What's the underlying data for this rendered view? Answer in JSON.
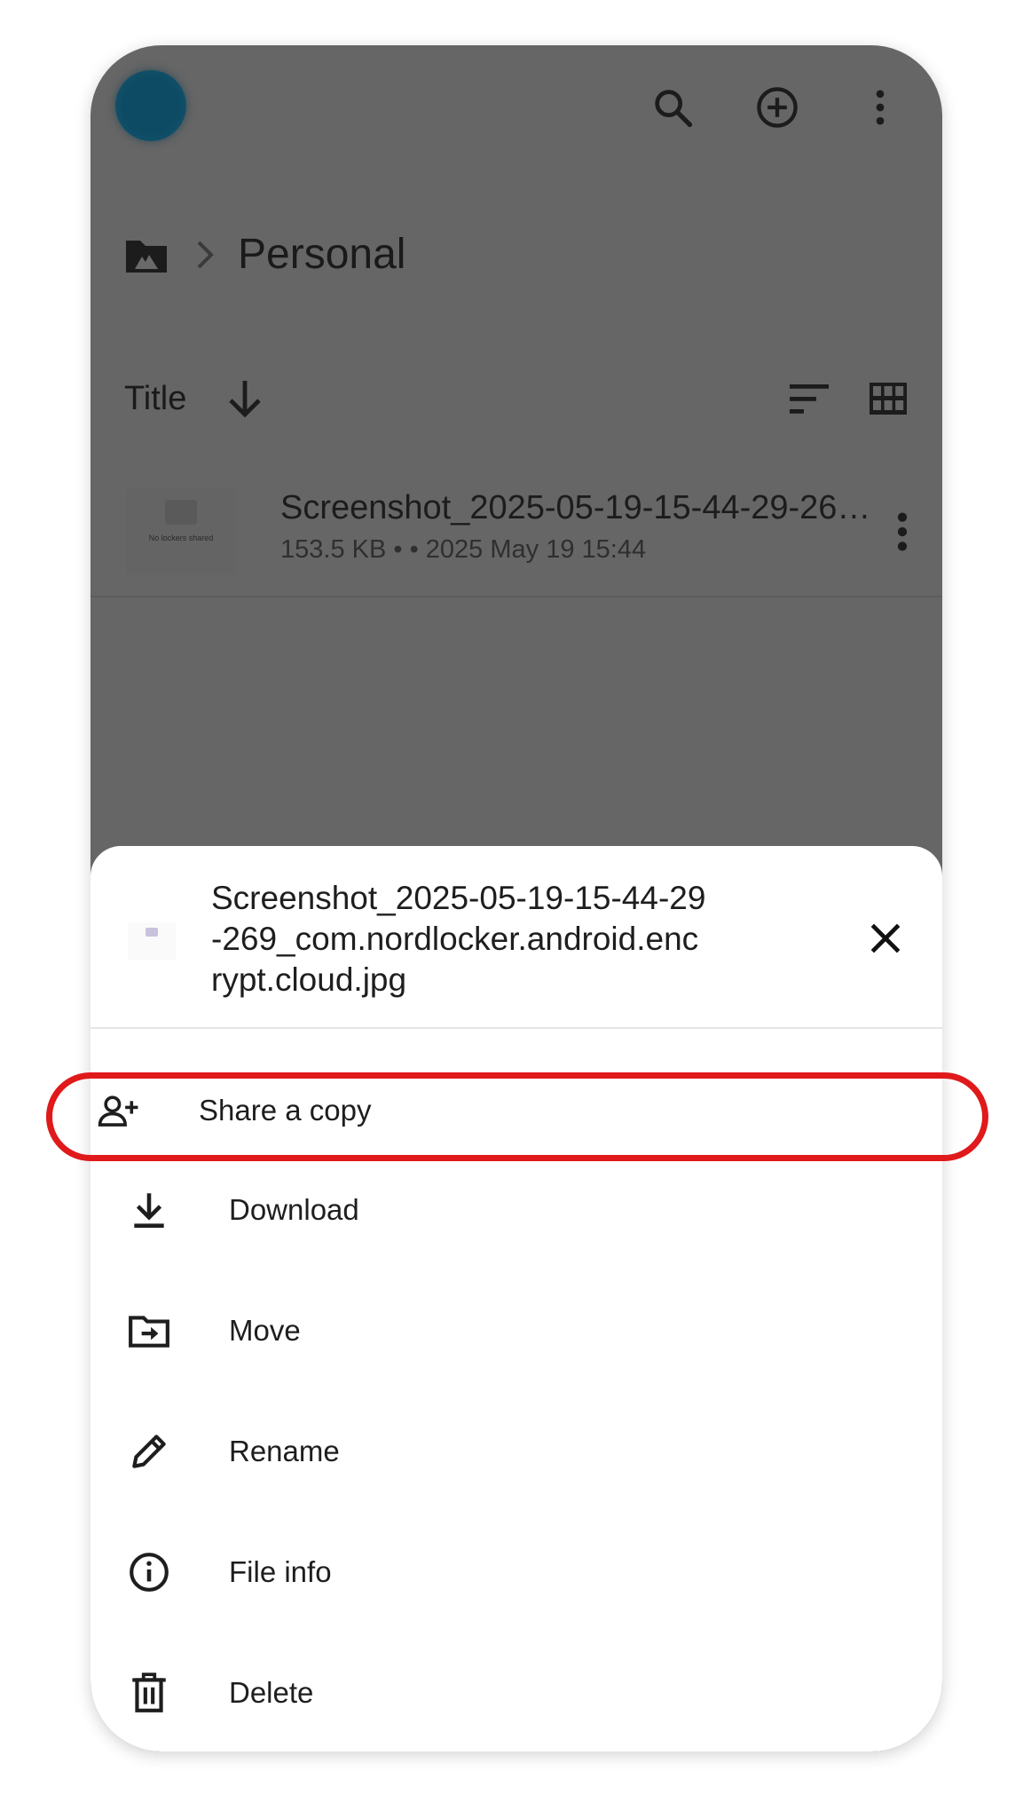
{
  "app": {
    "topbar": {
      "icons": [
        "search-icon",
        "add-circle-icon",
        "more-vert-icon"
      ]
    },
    "breadcrumb": {
      "root_icon": "locker-folder-icon",
      "separator_icon": "chevron-right-icon",
      "current": "Personal"
    },
    "sort": {
      "label": "Title",
      "direction_icon": "arrow-down-icon",
      "icons": [
        "sort-icon",
        "grid-view-icon"
      ]
    },
    "files": [
      {
        "name": "Screenshot_2025-05-19-15-44-29-26…",
        "meta": "153.5 KB •  • 2025 May 19 15:44",
        "thumbnail_text": "No lockers shared"
      }
    ]
  },
  "sheet": {
    "file_title": "Screenshot_2025-05-19-15-44-29-269_com.nordlocker.android.encrypt.cloud.jpg",
    "close_icon": "close-icon",
    "items": [
      {
        "label": "Share a copy",
        "icon": "person-add-icon"
      },
      {
        "label": "Download",
        "icon": "download-icon"
      },
      {
        "label": "Move",
        "icon": "folder-move-icon"
      },
      {
        "label": "Rename",
        "icon": "pencil-icon"
      },
      {
        "label": "File info",
        "icon": "info-icon"
      },
      {
        "label": "Delete",
        "icon": "trash-icon"
      }
    ]
  },
  "colors": {
    "scrim": "#666666",
    "sheet_bg": "#ffffff",
    "highlight": "#e0191b",
    "text": "#1e1e1e"
  }
}
